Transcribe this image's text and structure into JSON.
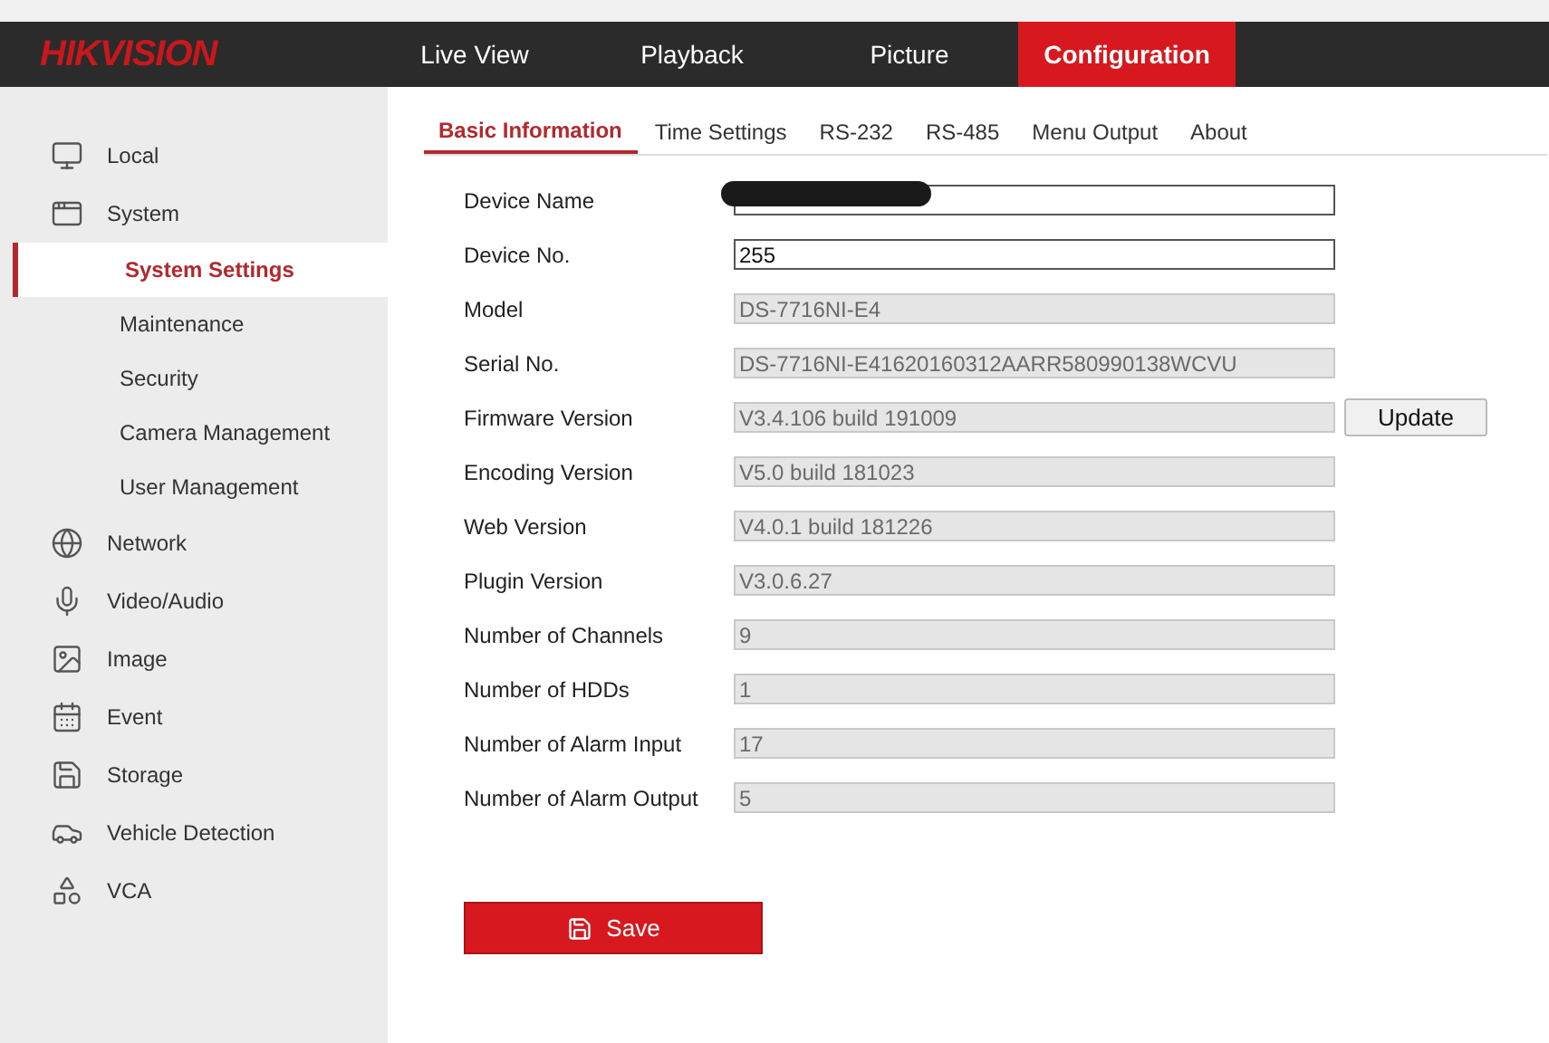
{
  "header": {
    "logo": "HIKVISION",
    "nav": [
      {
        "label": "Live View",
        "selected": false
      },
      {
        "label": "Playback",
        "selected": false
      },
      {
        "label": "Picture",
        "selected": false
      },
      {
        "label": "Configuration",
        "selected": true
      }
    ]
  },
  "sidebar": {
    "items": [
      {
        "label": "Local",
        "selected": false
      },
      {
        "label": "System",
        "selected": false,
        "children": [
          {
            "label": "System Settings",
            "selected": true
          },
          {
            "label": "Maintenance",
            "selected": false
          },
          {
            "label": "Security",
            "selected": false
          },
          {
            "label": "Camera Management",
            "selected": false
          },
          {
            "label": "User Management",
            "selected": false
          }
        ]
      },
      {
        "label": "Network",
        "selected": false
      },
      {
        "label": "Video/Audio",
        "selected": false
      },
      {
        "label": "Image",
        "selected": false
      },
      {
        "label": "Event",
        "selected": false
      },
      {
        "label": "Storage",
        "selected": false
      },
      {
        "label": "Vehicle Detection",
        "selected": false
      },
      {
        "label": "VCA",
        "selected": false
      }
    ]
  },
  "tabs": [
    {
      "label": "Basic Information",
      "selected": true
    },
    {
      "label": "Time Settings",
      "selected": false
    },
    {
      "label": "RS-232",
      "selected": false
    },
    {
      "label": "RS-485",
      "selected": false
    },
    {
      "label": "Menu Output",
      "selected": false
    },
    {
      "label": "About",
      "selected": false
    }
  ],
  "fields": [
    {
      "label": "Device Name",
      "disabled": false,
      "redacted": true
    },
    {
      "label": "Device No.",
      "value": "255",
      "disabled": false
    },
    {
      "label": "Model",
      "value": "DS-7716NI-E4",
      "disabled": true
    },
    {
      "label": "Serial No.",
      "value": "DS-7716NI-E41620160312AARR580990138WCVU",
      "disabled": true
    },
    {
      "label": "Firmware Version",
      "value": "V3.4.106 build 191009",
      "disabled": true,
      "button": "Update"
    },
    {
      "label": "Encoding Version",
      "value": "V5.0 build 181023",
      "disabled": true
    },
    {
      "label": "Web Version",
      "value": "V4.0.1 build 181226",
      "disabled": true
    },
    {
      "label": "Plugin Version",
      "value": "V3.0.6.27",
      "disabled": true
    },
    {
      "label": "Number of Channels",
      "value": "9",
      "disabled": true
    },
    {
      "label": "Number of HDDs",
      "value": "1",
      "disabled": true
    },
    {
      "label": "Number of Alarm Input",
      "value": "17",
      "disabled": true
    },
    {
      "label": "Number of Alarm Output",
      "value": "5",
      "disabled": true
    }
  ],
  "save_button": "Save"
}
